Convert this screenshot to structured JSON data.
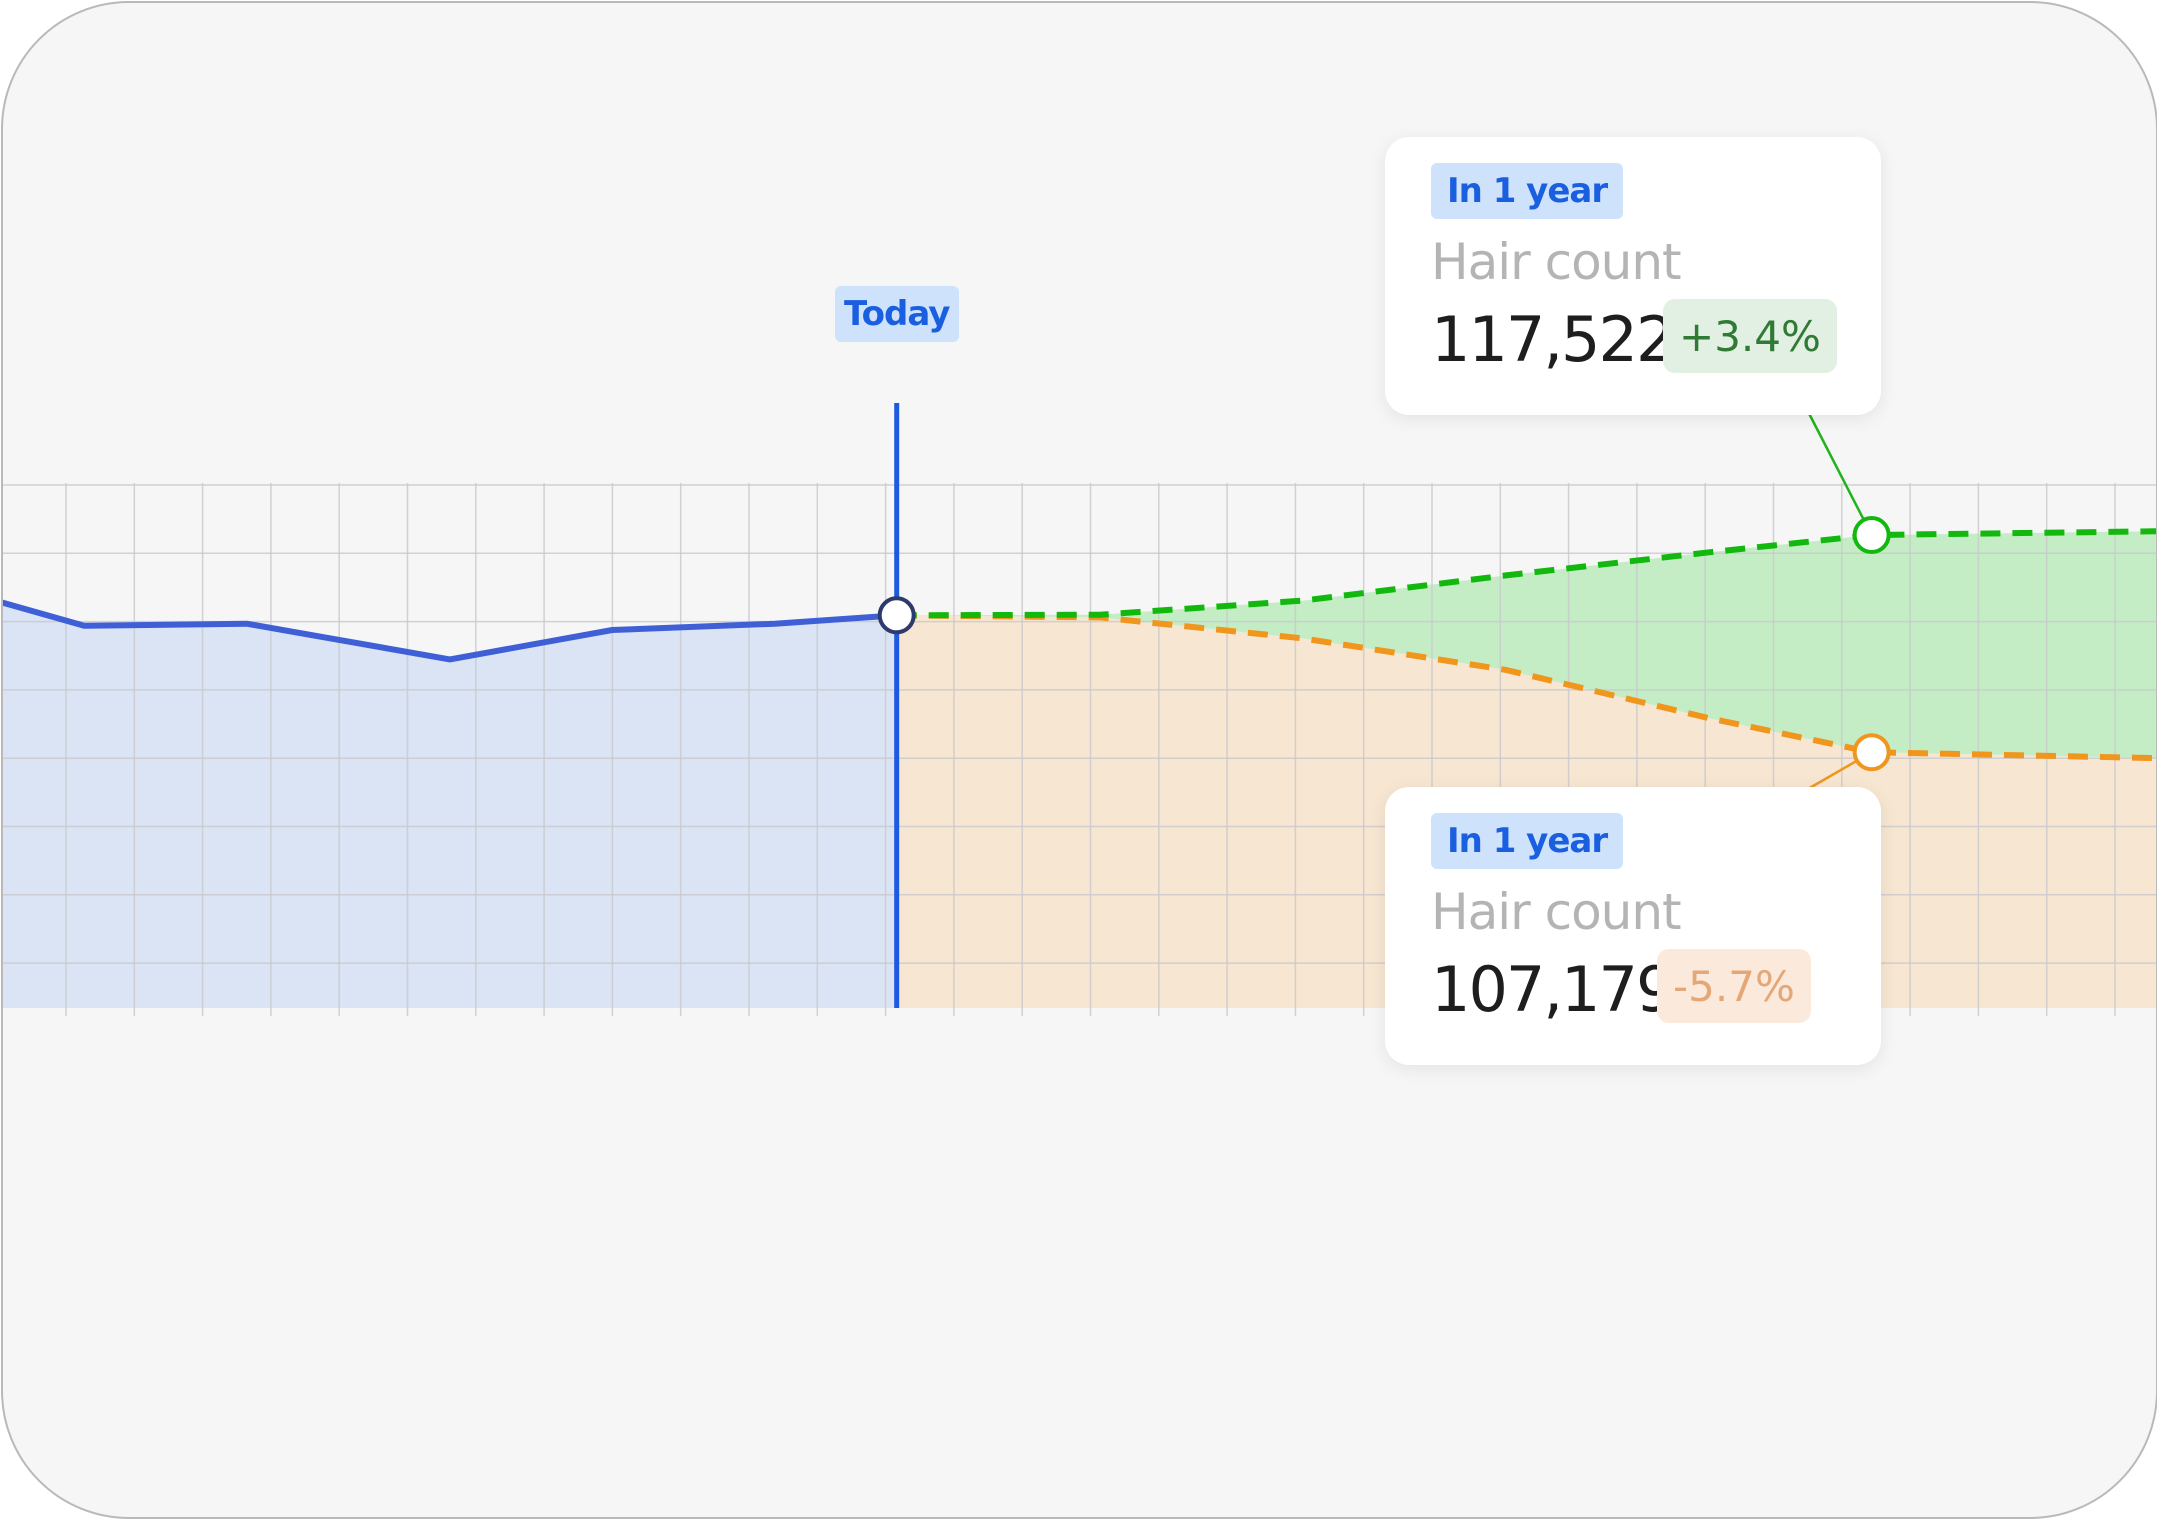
{
  "chart_data": {
    "type": "line",
    "title": "",
    "xlabel": "",
    "ylabel": "",
    "today_label": "Today",
    "series": [
      {
        "key": "history",
        "style": "solid",
        "color": "#3f5fd6",
        "fill": "#dae4f5",
        "points": [
          [
            -11,
            114300
          ],
          [
            -10,
            113200
          ],
          [
            -8,
            113300
          ],
          [
            -5.5,
            111600
          ],
          [
            -3.5,
            113000
          ],
          [
            -1.5,
            113300
          ],
          [
            0,
            113700
          ]
        ]
      },
      {
        "key": "optimistic",
        "style": "dashed",
        "color": "#13b80f",
        "fill": "#c5edc5",
        "points": [
          [
            0,
            113700
          ],
          [
            2.5,
            113730
          ],
          [
            5,
            114400
          ],
          [
            7.5,
            115600
          ],
          [
            10,
            116700
          ],
          [
            12,
            117522
          ],
          [
            15.5,
            117700
          ]
        ]
      },
      {
        "key": "pessimistic",
        "style": "dashed",
        "color": "#f0961d",
        "fill": "#f7e6d1",
        "points": [
          [
            0,
            113700
          ],
          [
            2.5,
            113600
          ],
          [
            5,
            112600
          ],
          [
            7.5,
            111100
          ],
          [
            10,
            108800
          ],
          [
            12,
            107179
          ],
          [
            15.5,
            106900
          ]
        ]
      }
    ],
    "xlim": [
      -11,
      15.5
    ],
    "ylim": [
      95000,
      120000
    ],
    "grid": true
  },
  "annotations": [
    {
      "key": "upper",
      "tag": "In 1 year",
      "metric": "Hair count",
      "value": "117,522",
      "delta": "+3.4%",
      "trend": "up",
      "color": "#1fb41c"
    },
    {
      "key": "lower",
      "tag": "In 1 year",
      "metric": "Hair count",
      "value": "107,179",
      "delta": "-5.7%",
      "trend": "down",
      "color": "#f0961d"
    }
  ],
  "colors": {
    "today_line": "#1d5ae0",
    "grid": "#c8c8cc",
    "background": "#f6f6f7"
  }
}
